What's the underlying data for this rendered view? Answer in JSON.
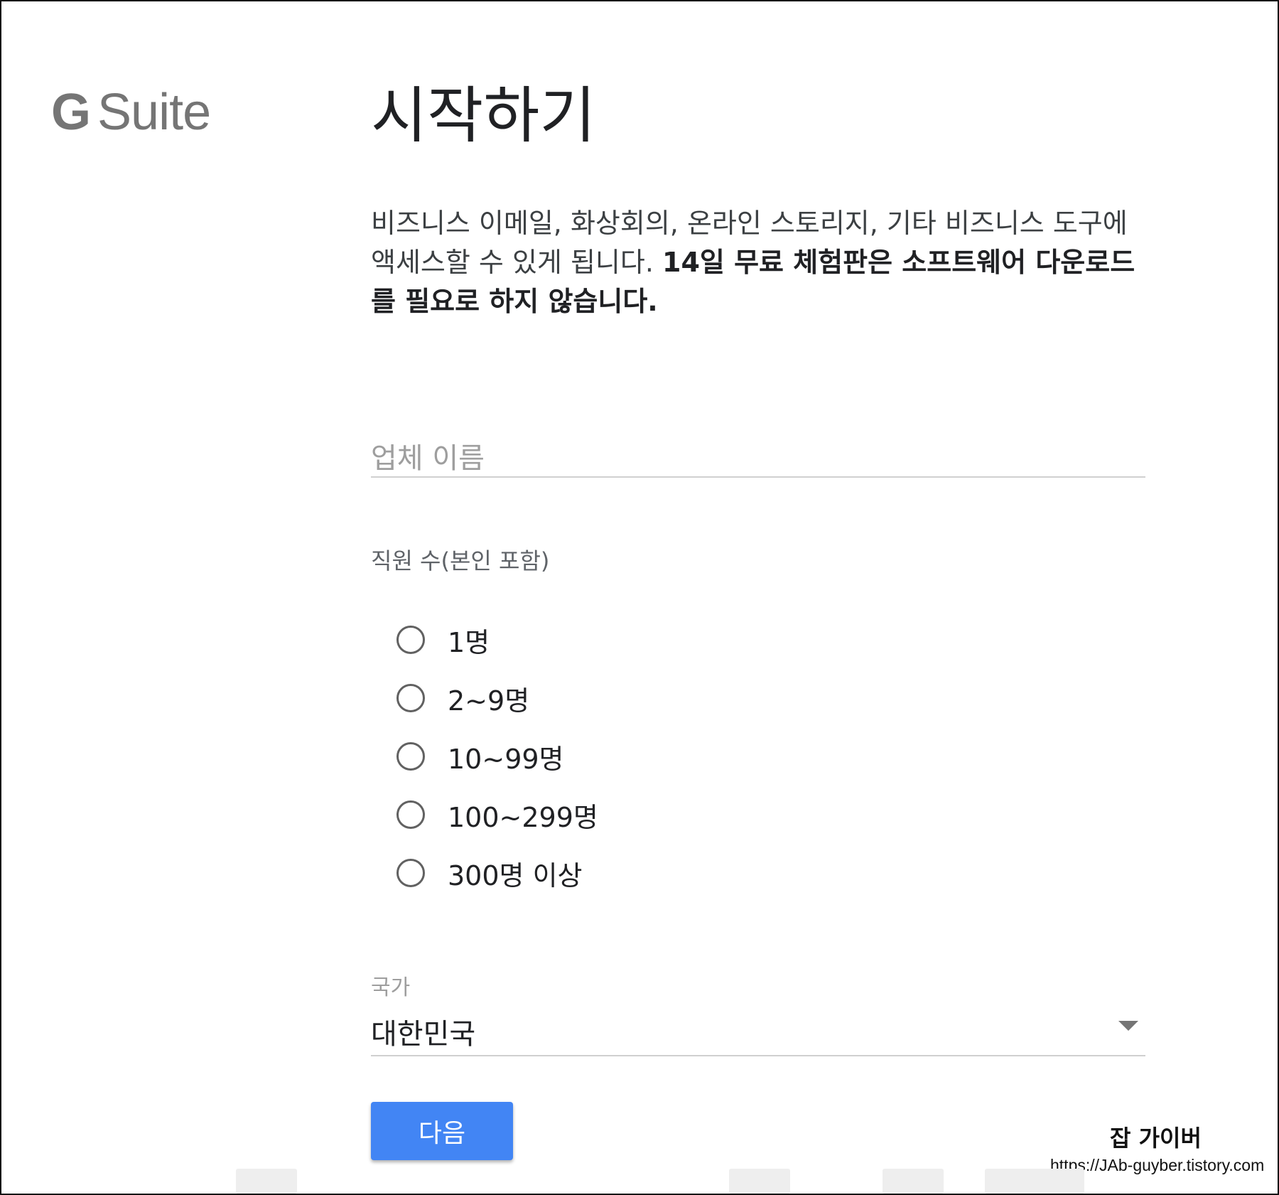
{
  "logo": {
    "g": "G",
    "suite": "Suite"
  },
  "title": "시작하기",
  "description": {
    "normal": "비즈니스 이메일, 화상회의, 온라인 스토리지, 기타 비즈니스 도구에 액세스할 수 있게 됩니다. ",
    "bold": "14일 무료 체험판은 소프트웨어 다운로드를 필요로 하지 않습니다."
  },
  "company_field": {
    "placeholder": "업체 이름",
    "value": ""
  },
  "employees": {
    "label": "직원 수(본인 포함)",
    "options": [
      "1명",
      "2~9명",
      "10~99명",
      "100~299명",
      "300명 이상"
    ],
    "selected": null
  },
  "country": {
    "label": "국가",
    "value": "대한민국"
  },
  "next_button": "다음",
  "watermark": {
    "name": "잡 가이버",
    "url": "https://JAb-guyber.tistory.com"
  }
}
